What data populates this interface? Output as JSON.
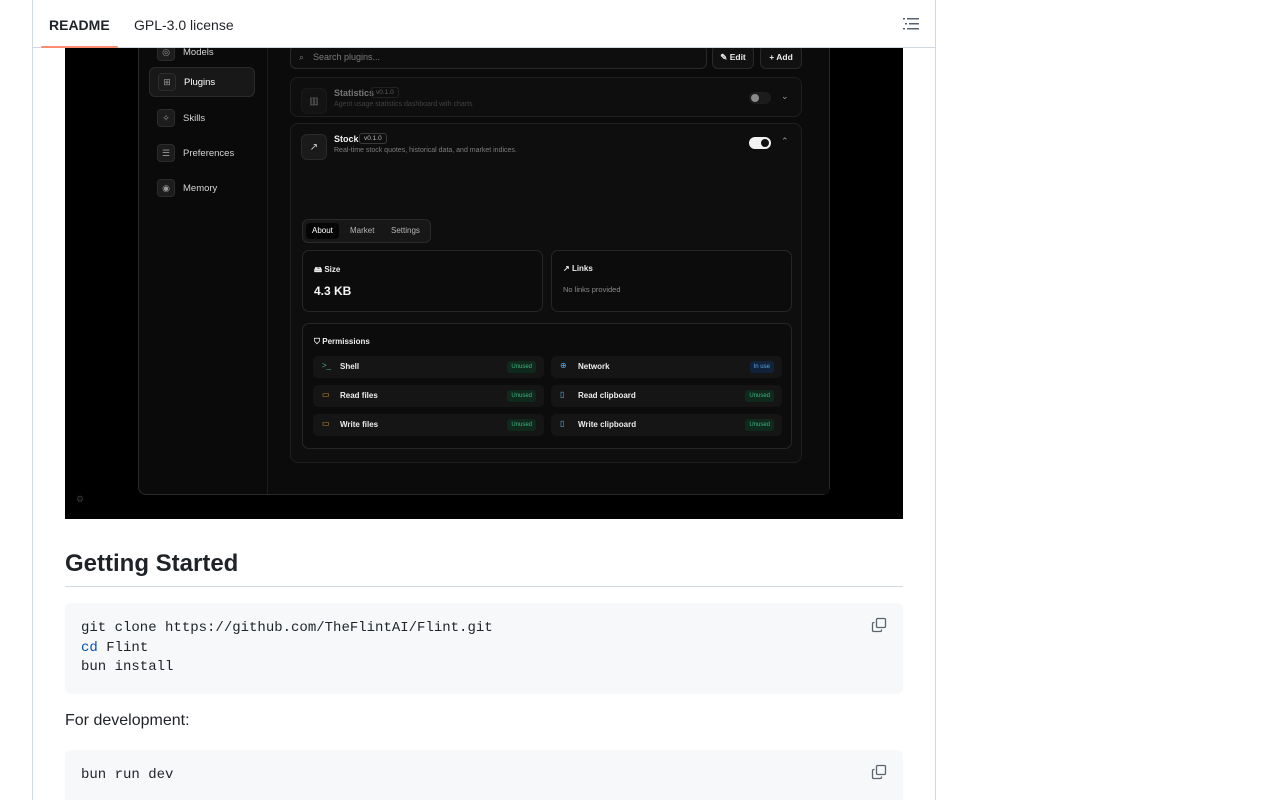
{
  "tabs": {
    "readme": "README",
    "license": "GPL-3.0 license"
  },
  "screenshot": {
    "sidebar": [
      {
        "label": "Models",
        "icon": "models-icon"
      },
      {
        "label": "Plugins",
        "icon": "plugins-icon"
      },
      {
        "label": "Skills",
        "icon": "skills-icon"
      },
      {
        "label": "Preferences",
        "icon": "preferences-icon"
      },
      {
        "label": "Memory",
        "icon": "memory-icon"
      }
    ],
    "search_placeholder": "Search plugins...",
    "edit_label": "Edit",
    "add_label": "Add",
    "statistics": {
      "name": "Statistics",
      "version": "v0.1.0",
      "desc": "Agent usage statistics dashboard with charts"
    },
    "stock": {
      "name": "Stock",
      "version": "v0.1.0",
      "desc": "Real-time stock quotes, historical data, and market indices."
    },
    "subtabs": [
      "About",
      "Market",
      "Settings"
    ],
    "size": {
      "title": "Size",
      "value": "4.3 KB"
    },
    "links": {
      "title": "Links",
      "value": "No links provided"
    },
    "permissions": {
      "title": "Permissions",
      "items": [
        {
          "name": "Shell",
          "status": "Unused"
        },
        {
          "name": "Network",
          "status": "In use"
        },
        {
          "name": "Read files",
          "status": "Unused"
        },
        {
          "name": "Read clipboard",
          "status": "Unused"
        },
        {
          "name": "Write files",
          "status": "Unused"
        },
        {
          "name": "Write clipboard",
          "status": "Unused"
        }
      ]
    }
  },
  "getting_started": {
    "heading": "Getting Started",
    "code1": {
      "line1": "git clone https://github.com/TheFlintAI/Flint.git",
      "line2_kw": "cd",
      "line2_rest": " Flint",
      "line3": "bun install"
    },
    "dev_text": "For development:",
    "code2": {
      "line1": "bun run dev"
    }
  }
}
